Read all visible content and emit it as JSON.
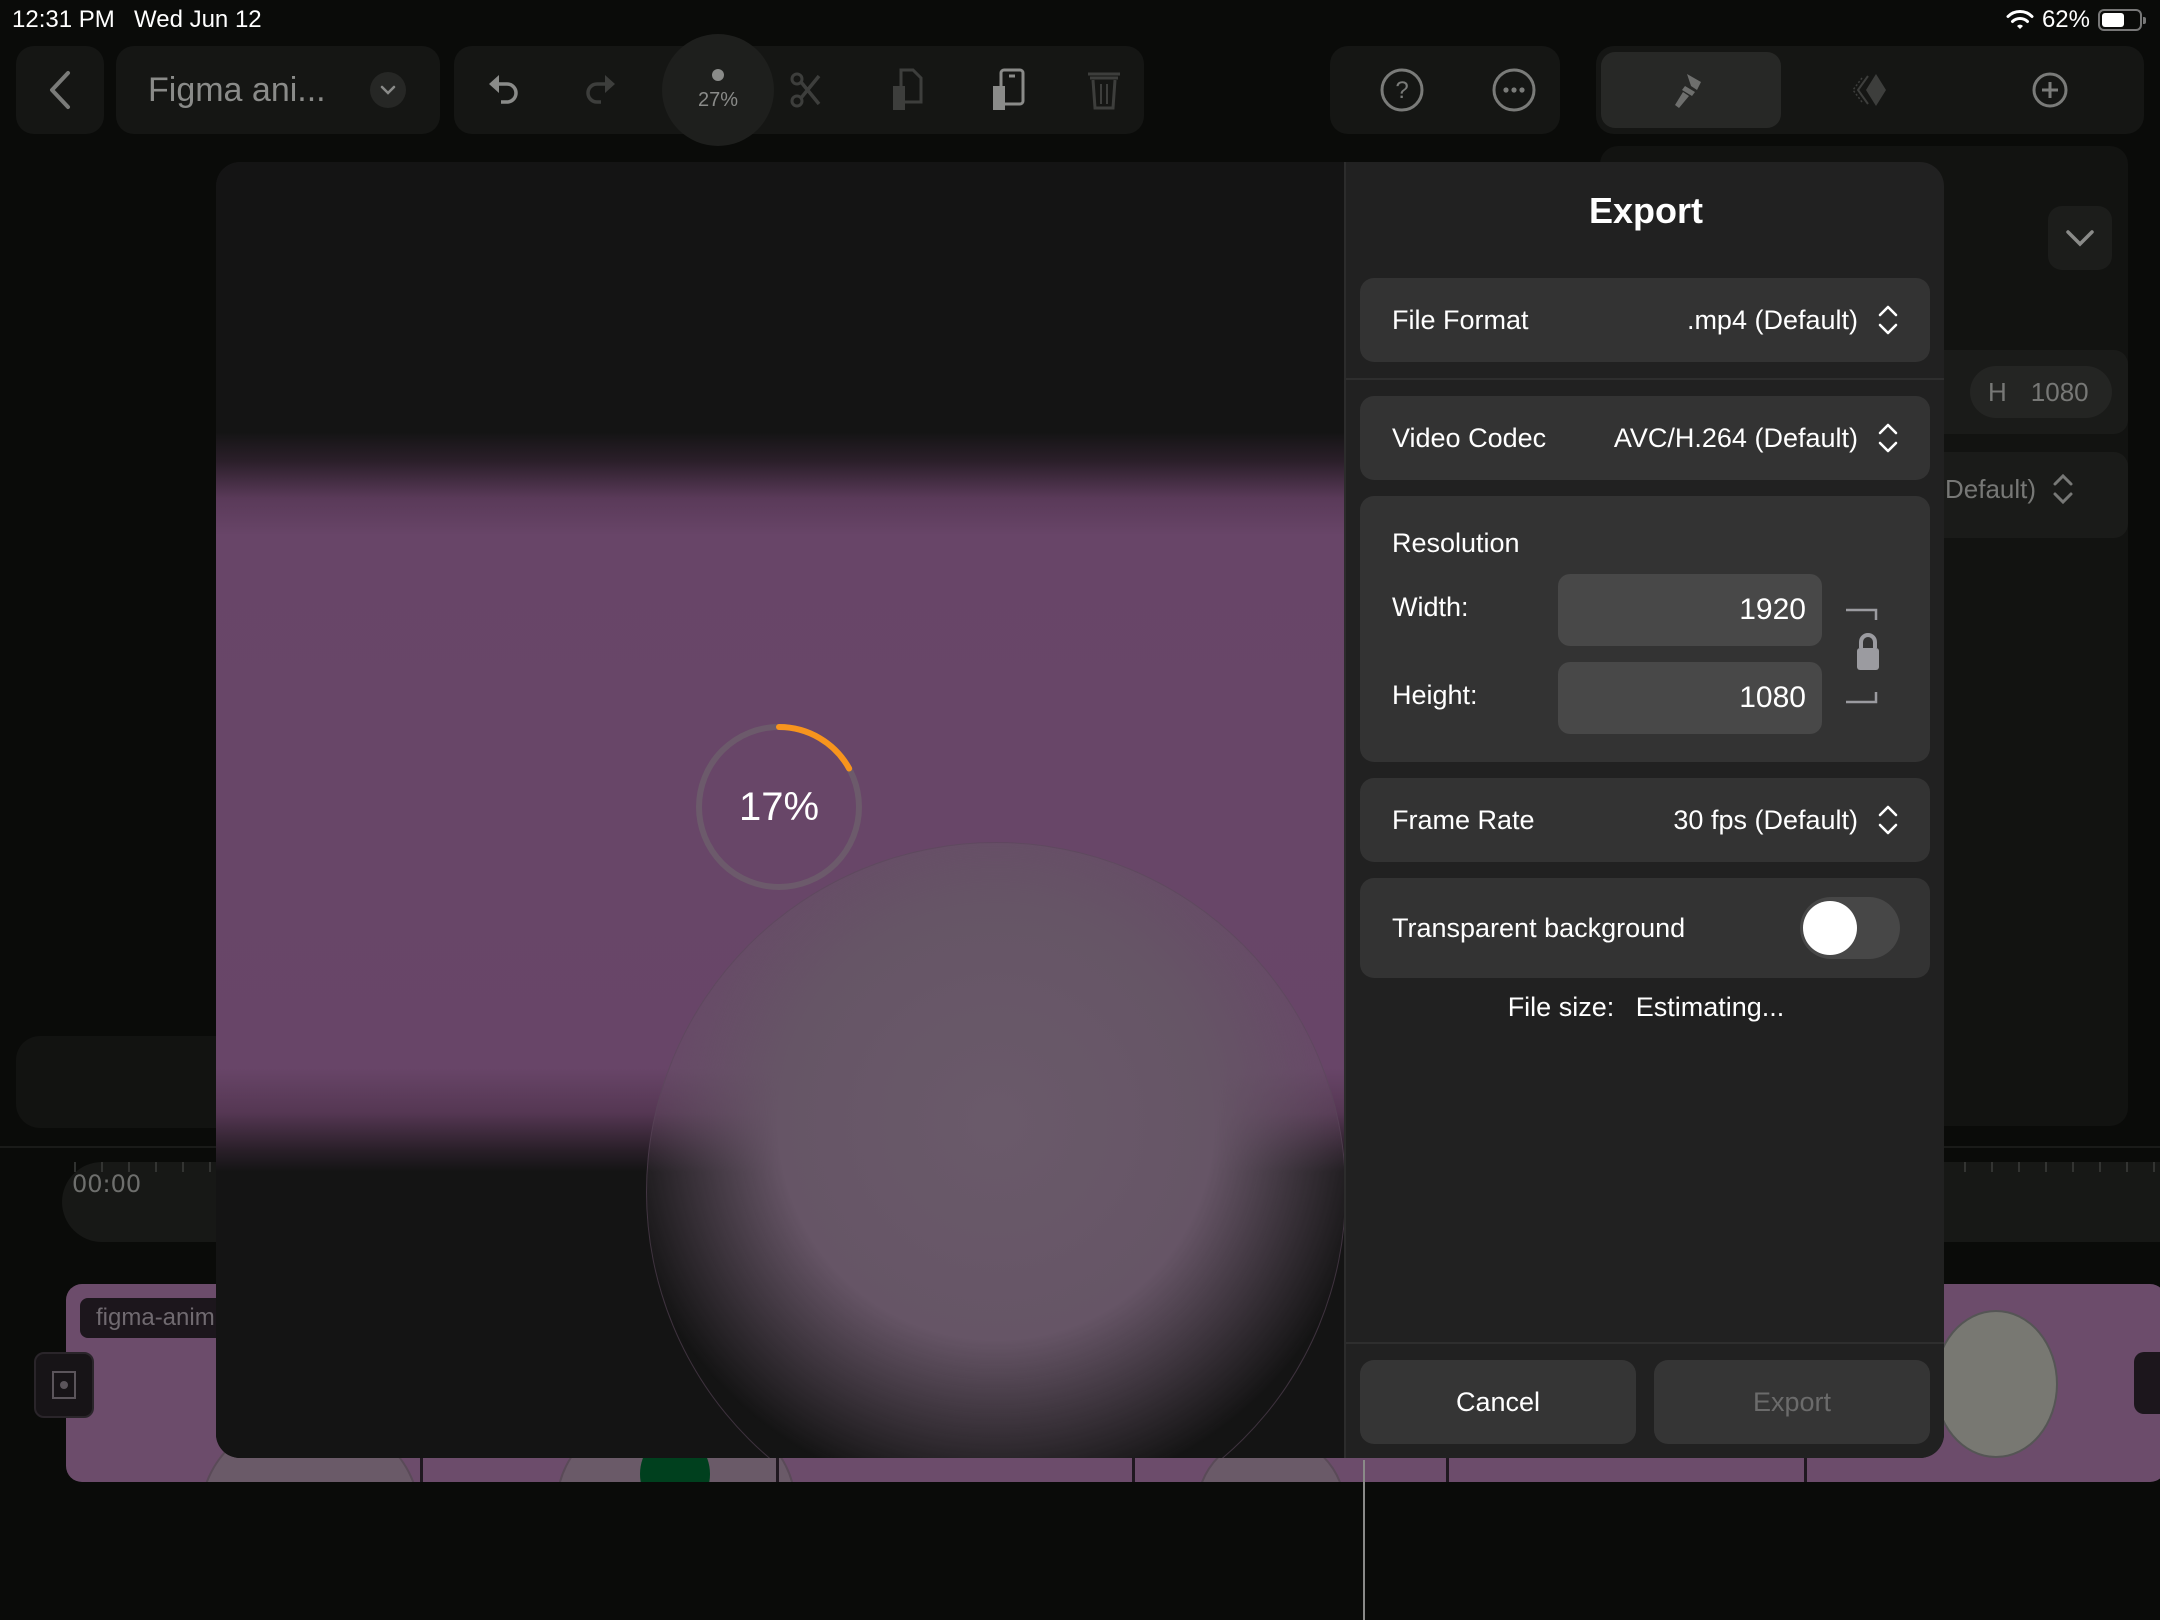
{
  "status_bar": {
    "time": "12:31 PM",
    "date": "Wed Jun 12",
    "battery_percent": "62%",
    "battery_level": 0.62
  },
  "toolbar": {
    "document_title": "Figma ani...",
    "zoom_level": "27%",
    "icons": {
      "back": "chevron-left-icon",
      "title_menu": "chevron-down-icon",
      "undo": "undo-icon",
      "redo": "redo-icon",
      "cut": "scissors-icon",
      "copy": "copy-icon",
      "paste": "paste-icon",
      "delete": "trash-icon",
      "help": "question-icon",
      "more": "ellipsis-icon",
      "style": "paintbrush-icon",
      "animate": "keyframes-icon",
      "add": "plus-circle-icon"
    }
  },
  "inspector_bg": {
    "height_label": "H",
    "height_value": "1080",
    "default_text": "Default)"
  },
  "timeline": {
    "time_start": "00:00",
    "clip_label": "figma-anim"
  },
  "export_dialog": {
    "progress_label": "17%",
    "progress_value": 0.17,
    "title": "Export",
    "file_format": {
      "label": "File Format",
      "value": ".mp4 (Default)"
    },
    "video_codec": {
      "label": "Video Codec",
      "value": "AVC/H.264 (Default)"
    },
    "resolution": {
      "title": "Resolution",
      "width_label": "Width:",
      "width_value": "1920",
      "height_label": "Height:",
      "height_value": "1080",
      "aspect_locked": true
    },
    "frame_rate": {
      "label": "Frame Rate",
      "value": "30 fps (Default)"
    },
    "transparent_background": {
      "label": "Transparent background",
      "enabled": false
    },
    "file_size": {
      "label": "File size:",
      "value": "Estimating..."
    },
    "buttons": {
      "cancel": "Cancel",
      "export": "Export"
    }
  },
  "colors": {
    "accent_progress": "#f7941d",
    "preview_purple": "#684668",
    "panel_bg": "#212121",
    "row_bg": "#333333"
  }
}
